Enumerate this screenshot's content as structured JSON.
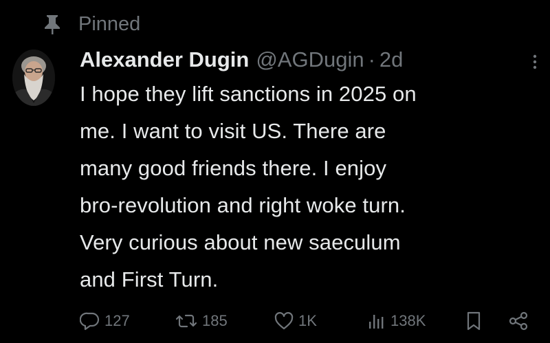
{
  "pinned": {
    "label": "Pinned",
    "icon": "pin-icon"
  },
  "author": {
    "display_name": "Alexander Dugin",
    "handle": "@AGDugin",
    "separator": "·",
    "time": "2d",
    "avatar": "avatar"
  },
  "tweet": {
    "lines": [
      "I hope they lift sanctions in 2025 on",
      "me. I want to visit US. There are",
      "many good friends there. I enjoy",
      "bro-revolution and right woke turn.",
      "Very curious about new saeculum",
      "and First Turn."
    ]
  },
  "actions": {
    "replies": {
      "icon": "reply-icon",
      "count": "127"
    },
    "reposts": {
      "icon": "repost-icon",
      "count": "185"
    },
    "likes": {
      "icon": "heart-icon",
      "count": "1K"
    },
    "views": {
      "icon": "views-icon",
      "count": "138K"
    },
    "bookmark": {
      "icon": "bookmark-icon"
    },
    "share": {
      "icon": "share-icon"
    }
  },
  "colors": {
    "background": "#000000",
    "primary_text": "#e7e9ea",
    "secondary_text": "#71767b"
  }
}
